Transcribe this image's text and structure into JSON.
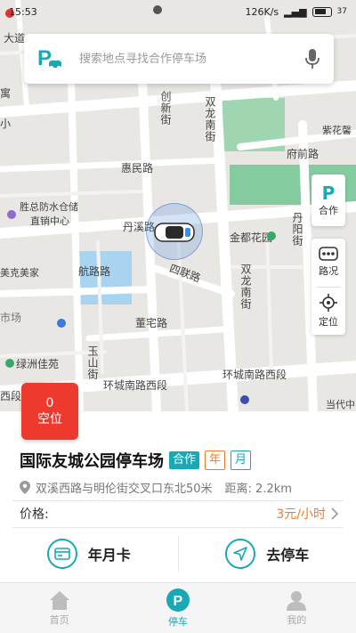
{
  "status_bar": {
    "time": "15:53",
    "speed": "126K/s",
    "battery": "37"
  },
  "search": {
    "placeholder": "搜索地点寻找合作停车场"
  },
  "map": {
    "labels": {
      "dadao": "大道",
      "yu": "寓",
      "xiao": "小",
      "huiminlu": "惠民路",
      "chuangxinjie": "创新街",
      "shuanglongnanjie_top": "双龙南街",
      "zijinghe": "紫花馨",
      "fuqianlu": "府前路",
      "shengzongfangshui_1": "胜总防水仓储",
      "shengzongfangshui_2": "直销中心",
      "danxilu": "丹溪路",
      "jindugongyuan": "金都花园",
      "danyangjie": "丹阳街",
      "hanglulu": "航路路",
      "sichenlu": "四联路",
      "meiyuanmeijia": "美克美家",
      "shichang": "市场",
      "dongzhailu": "董宅路",
      "shuanglongnanjie_bottom": "双龙南街",
      "lvzhoujiayuan": "绿洲佳苑",
      "yushanjie": "玉山街",
      "huanchengnanlu": "环城南路西段",
      "huanchengnanlu_right": "环城南路西段",
      "xi": "西段",
      "dangdai": "当代中"
    }
  },
  "tools": {
    "coop_icon": "P",
    "coop_label": "合作",
    "traffic_label": "路况",
    "locate_label": "定位"
  },
  "vacancy": {
    "count": "0",
    "label": "空位"
  },
  "lot": {
    "name": "国际友城公园停车场",
    "tag_coop": "合作",
    "tag_year": "年",
    "tag_month": "月",
    "address": "双溪西路与明伦街交叉口东北50米",
    "distance": "距离: 2.2km",
    "price_label": "价格:",
    "price_value": "3元/小时"
  },
  "actions": {
    "card_label": "年月卡",
    "park_label": "去停车"
  },
  "tabbar": {
    "home": "首页",
    "parking": "停车",
    "mine": "我的"
  },
  "colors": {
    "accent": "#1aa8b5",
    "orange": "#f07a2a",
    "red": "#ee3a2e",
    "park_green": "#7fc79a"
  }
}
